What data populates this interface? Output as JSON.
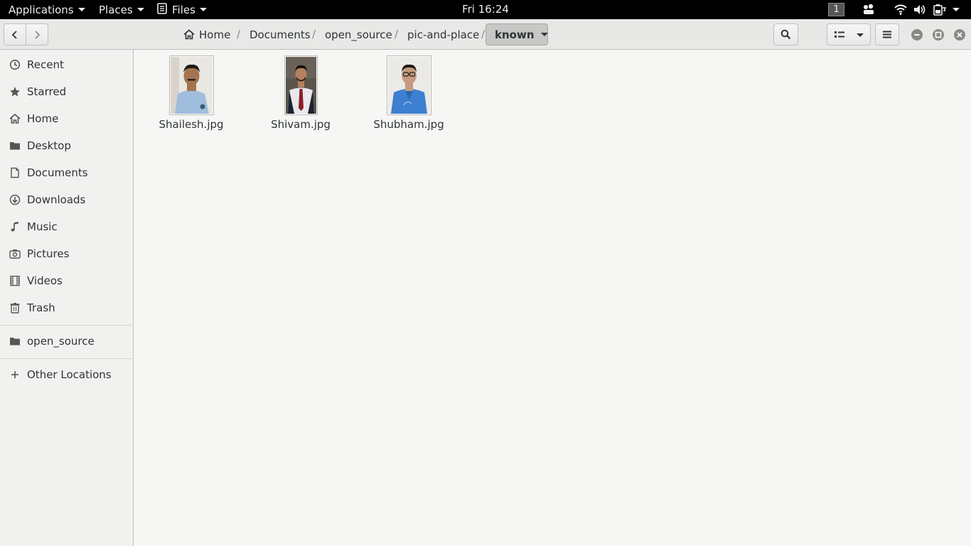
{
  "topbar": {
    "applications": "Applications",
    "places": "Places",
    "files": "Files",
    "clock": "Fri 16:24",
    "workspace": "1",
    "icons": [
      "people-icon",
      "wifi-icon",
      "volume-icon",
      "battery-icon",
      "system-menu-caret-icon"
    ]
  },
  "header": {
    "breadcrumbs": [
      "Home",
      "Documents",
      "open_source",
      "pic-and-place"
    ],
    "current_folder": "known",
    "icons": [
      "back-icon",
      "forward-icon",
      "home-icon",
      "search-icon",
      "list-view-icon",
      "view-options-icon",
      "hamburger-menu-icon",
      "minimize-icon",
      "maximize-icon",
      "close-icon"
    ]
  },
  "sidebar": {
    "items": [
      {
        "label": "Recent",
        "icon": "clock-icon"
      },
      {
        "label": "Starred",
        "icon": "star-icon"
      },
      {
        "label": "Home",
        "icon": "home-icon"
      },
      {
        "label": "Desktop",
        "icon": "folder-icon"
      },
      {
        "label": "Documents",
        "icon": "document-icon"
      },
      {
        "label": "Downloads",
        "icon": "download-icon"
      },
      {
        "label": "Music",
        "icon": "music-icon"
      },
      {
        "label": "Pictures",
        "icon": "camera-icon"
      },
      {
        "label": "Videos",
        "icon": "film-icon"
      },
      {
        "label": "Trash",
        "icon": "trash-icon"
      }
    ],
    "bookmarks": [
      {
        "label": "open_source",
        "icon": "folder-icon"
      }
    ],
    "other": {
      "label": "Other Locations",
      "icon": "plus-icon"
    }
  },
  "files": [
    {
      "name": "Shailesh.jpg"
    },
    {
      "name": "Shivam.jpg"
    },
    {
      "name": "Shubham.jpg"
    }
  ],
  "colors": {
    "topbar_bg": "#000000",
    "headerbar_bg": "#e8e8e7",
    "sidebar_bg": "#f1f1f0",
    "main_bg": "#f6f6f5",
    "text": "#2e3436"
  }
}
